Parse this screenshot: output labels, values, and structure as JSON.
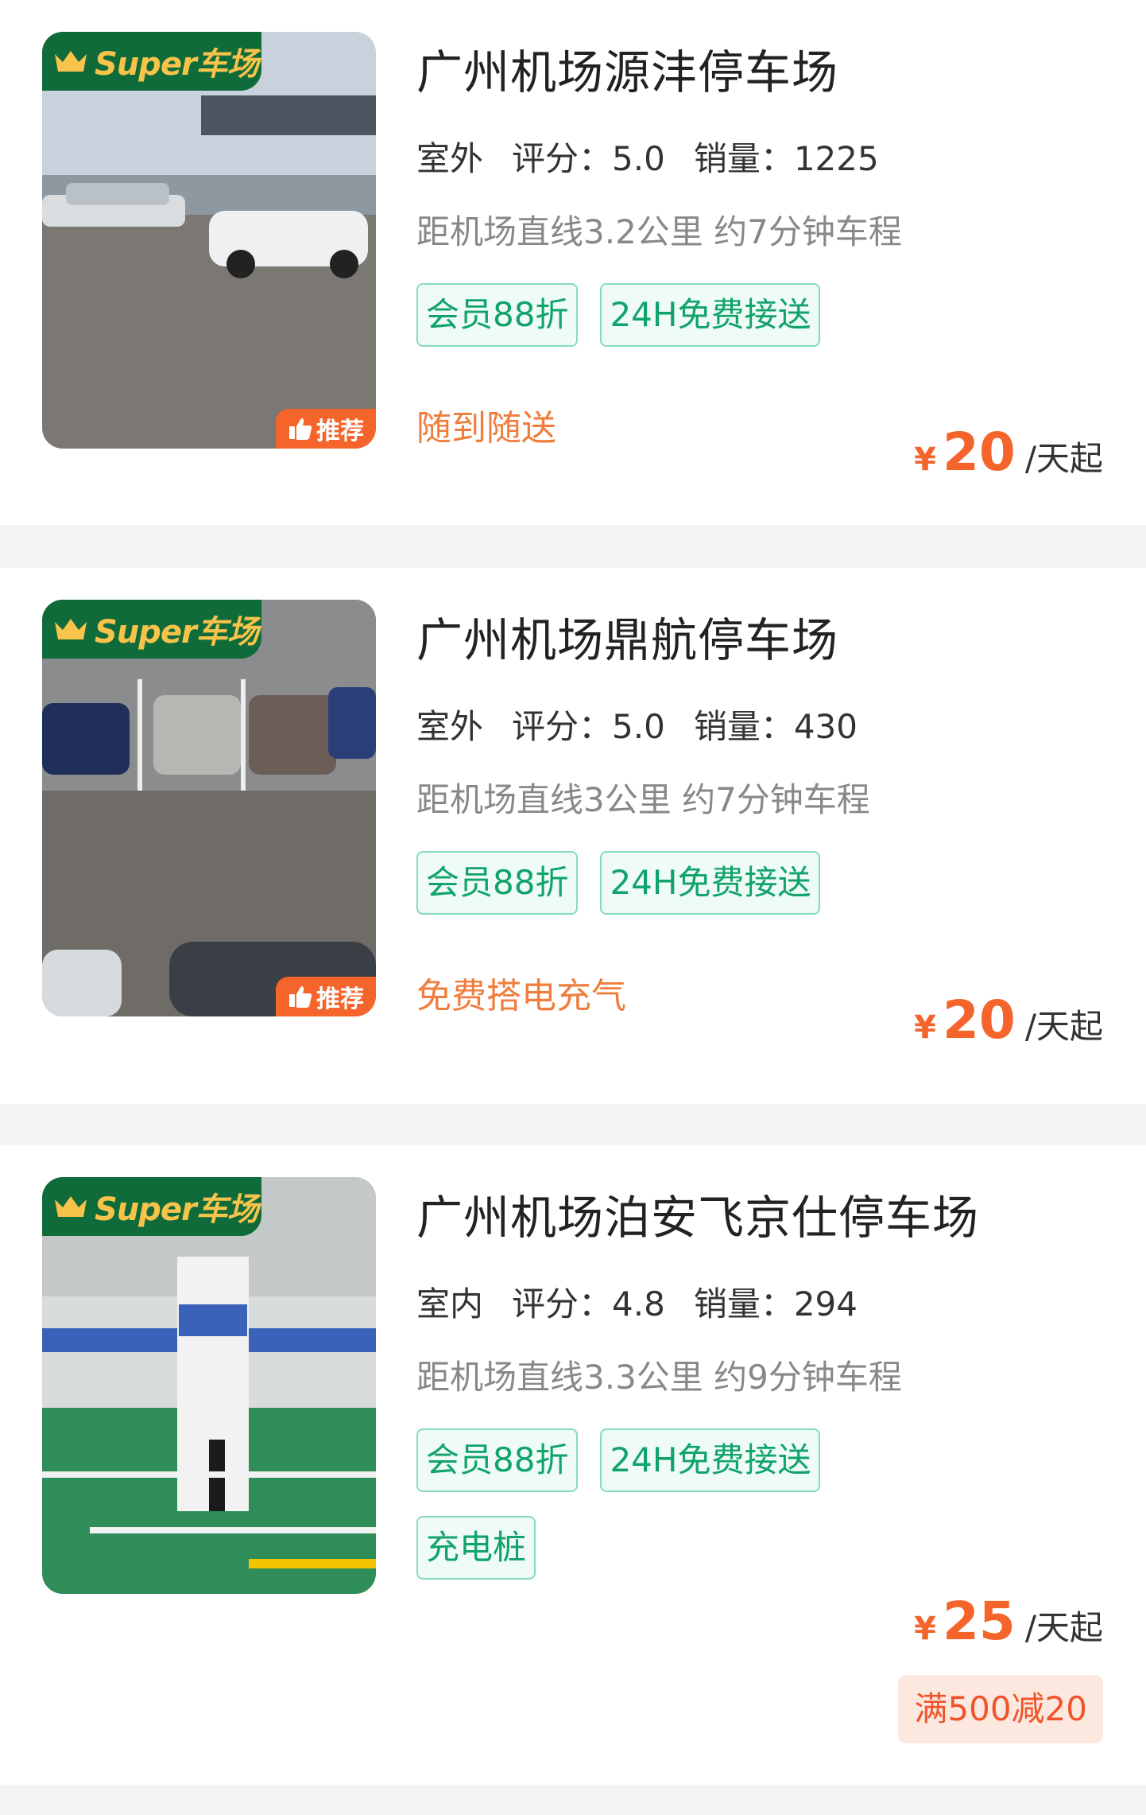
{
  "lots": [
    {
      "badge": "Super车场",
      "recommend": "推荐",
      "name": "广州机场源沣停车场",
      "type": "室外",
      "rating": "评分：5.0",
      "sales": "销量：1225",
      "distance": "距机场直线3.2公里 约7分钟车程",
      "tags": [
        "会员88折",
        "24H免费接送"
      ],
      "feature": "随到随送",
      "price_symbol": "¥",
      "price": "20",
      "price_unit": "/天起"
    },
    {
      "badge": "Super车场",
      "recommend": "推荐",
      "name": "广州机场鼎航停车场",
      "type": "室外",
      "rating": "评分：5.0",
      "sales": "销量：430",
      "distance": "距机场直线3公里 约7分钟车程",
      "tags": [
        "会员88折",
        "24H免费接送"
      ],
      "feature": "免费搭电充气",
      "price_symbol": "¥",
      "price": "20",
      "price_unit": "/天起"
    },
    {
      "badge": "Super车场",
      "name": "广州机场泊安飞京仕停车场",
      "type": "室内",
      "rating": "评分：4.8",
      "sales": "销量：294",
      "distance": "距机场直线3.3公里 约9分钟车程",
      "tags": [
        "会员88折",
        "24H免费接送",
        "充电桩"
      ],
      "price_symbol": "¥",
      "price": "25",
      "price_unit": "/天起",
      "coupon": "满500减20"
    }
  ],
  "colors": {
    "badge_bg": "#0f6b3a",
    "badge_text": "#f7c34a",
    "accent": "#f5642a",
    "tag_green": "#11a36b",
    "feature_orange": "#f07d3c"
  }
}
